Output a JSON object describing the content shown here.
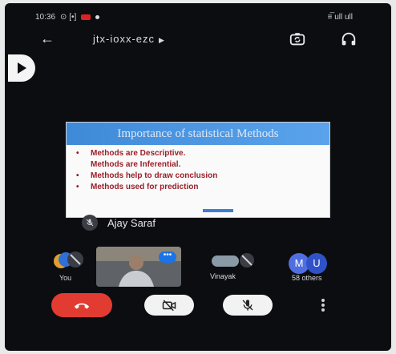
{
  "status_bar": {
    "time": "10:36",
    "left_indicators": "⊙ [•]",
    "right_indicators": "≡̅ ull ull"
  },
  "header": {
    "meeting_code": "jtx-ioxx-ezc"
  },
  "slide": {
    "title": "Importance of statistical Methods",
    "bullets": [
      "Methods are Descriptive.",
      "Methods are Inferential.",
      "Methods help to draw conclusion",
      "Methods used for prediction"
    ]
  },
  "presenter": {
    "name": "Ajay Saraf"
  },
  "participants": {
    "you_label": "You",
    "vinayak_label": "Vinayak",
    "others_label": "58 others",
    "others_initials": [
      "M",
      "U"
    ]
  },
  "colors": {
    "end_call": "#e23b32",
    "accent_blue": "#1a73e8",
    "slide_header": "#4a94e2",
    "slide_text": "#9a1e28"
  }
}
